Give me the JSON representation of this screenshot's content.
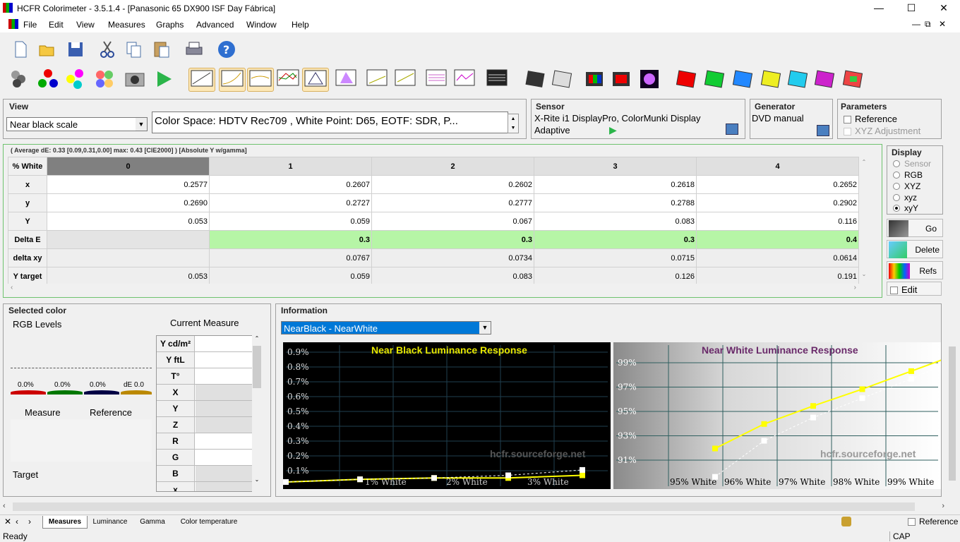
{
  "window": {
    "title": "HCFR Colorimeter - 3.5.1.4 - [Panasonic 65 DX900 ISF Day Fábrica]",
    "min": "—",
    "max": "☐",
    "close": "✕"
  },
  "menu": [
    "File",
    "Edit",
    "View",
    "Measures",
    "Graphs",
    "Advanced",
    "Window",
    "Help"
  ],
  "view": {
    "title": "View",
    "select": "Near black scale",
    "colorspace": "Color Space: HDTV Rec709 , White Point: D65, EOTF:  SDR, P..."
  },
  "sensor": {
    "title": "Sensor",
    "line1": "X-Rite i1 DisplayPro, ColorMunki Display",
    "line2": "Adaptive"
  },
  "generator": {
    "title": "Generator",
    "value": "DVD manual"
  },
  "parameters": {
    "title": "Parameters",
    "reference": "Reference",
    "xyz": "XYZ Adjustment"
  },
  "summary": "( Average dE: 0.33 [0.09,0.31,0.00] max: 0.43 [CIE2000] ) [Absolute Y w/gamma]",
  "table": {
    "corner": "% White",
    "columns": [
      "0",
      "1",
      "2",
      "3",
      "4"
    ],
    "rows": [
      {
        "label": "x",
        "values": [
          "0.2577",
          "0.2607",
          "0.2602",
          "0.2618",
          "0.2652"
        ]
      },
      {
        "label": "y",
        "values": [
          "0.2690",
          "0.2727",
          "0.2777",
          "0.2788",
          "0.2902"
        ]
      },
      {
        "label": "Y",
        "values": [
          "0.053",
          "0.059",
          "0.067",
          "0.083",
          "0.116"
        ]
      },
      {
        "label": "Delta E",
        "values": [
          "",
          "0.3",
          "0.3",
          "0.3",
          "0.4"
        ]
      },
      {
        "label": "delta xy",
        "values": [
          "",
          "0.0767",
          "0.0734",
          "0.0715",
          "0.0614"
        ]
      },
      {
        "label": "Y target",
        "values": [
          "0.053",
          "0.059",
          "0.083",
          "0.126",
          "0.191"
        ]
      }
    ]
  },
  "display": {
    "title": "Display",
    "options": [
      "Sensor",
      "RGB",
      "XYZ",
      "xyz",
      "xyY"
    ],
    "selected": "xyY"
  },
  "side": {
    "go": "Go",
    "delete": "Delete",
    "refs": "Refs",
    "edit": "Edit"
  },
  "selected": {
    "title": "Selected color",
    "rgb": "RGB Levels",
    "current": "Current Measure",
    "r": "0.0%",
    "g": "0.0%",
    "b": "0.0%",
    "de": "dE 0.0",
    "measure": "Measure",
    "reference": "Reference",
    "target": "Target",
    "rows": [
      "Y cd/m²",
      "Y ftL",
      "T°",
      "X",
      "Y",
      "Z",
      "R",
      "G",
      "B",
      "x"
    ]
  },
  "info": {
    "title": "Information",
    "select": "NearBlack - NearWhite"
  },
  "chart_data": [
    {
      "type": "line",
      "title": "Near Black Luminance Response",
      "watermark": "hcfr.sourceforge.net",
      "yticks": [
        "0.9%",
        "0.8%",
        "0.7%",
        "0.6%",
        "0.5%",
        "0.4%",
        "0.3%",
        "0.2%",
        "0.1%"
      ],
      "xticks": [
        "1% White",
        "2% White",
        "3% White"
      ],
      "x": [
        0,
        1,
        2,
        3,
        4
      ],
      "series": [
        {
          "values": [
            0.0,
            0.02,
            0.03,
            0.03,
            0.05
          ]
        },
        {
          "values": [
            0.0,
            0.02,
            0.03,
            0.05,
            0.09
          ]
        }
      ],
      "ylim": [
        0,
        1.0
      ],
      "colors": [
        "#ffff00",
        "#ffffff"
      ]
    },
    {
      "type": "line",
      "title": "Near White Luminance Response",
      "watermark": "hcfr.sourceforge.net",
      "yticks": [
        "99%",
        "97%",
        "95%",
        "93%",
        "91%"
      ],
      "xticks": [
        "95% White",
        "96% White",
        "97% White",
        "98% White",
        "99% White"
      ],
      "x": [
        95,
        96,
        97,
        98,
        99,
        100
      ],
      "series": [
        {
          "values": [
            92.2,
            94.1,
            95.5,
            96.8,
            98.2,
            99.6
          ]
        },
        {
          "values": [
            90.0,
            92.8,
            94.6,
            96.1,
            97.6,
            99.3
          ]
        }
      ],
      "ylim": [
        89.6,
        100
      ],
      "colors": [
        "#ffff00",
        "#ffffff"
      ]
    }
  ],
  "tabs": [
    "Measures",
    "Luminance",
    "Gamma",
    "Color temperature"
  ],
  "status": {
    "ready": "Ready",
    "cap": "CAP",
    "reference": "Reference"
  }
}
